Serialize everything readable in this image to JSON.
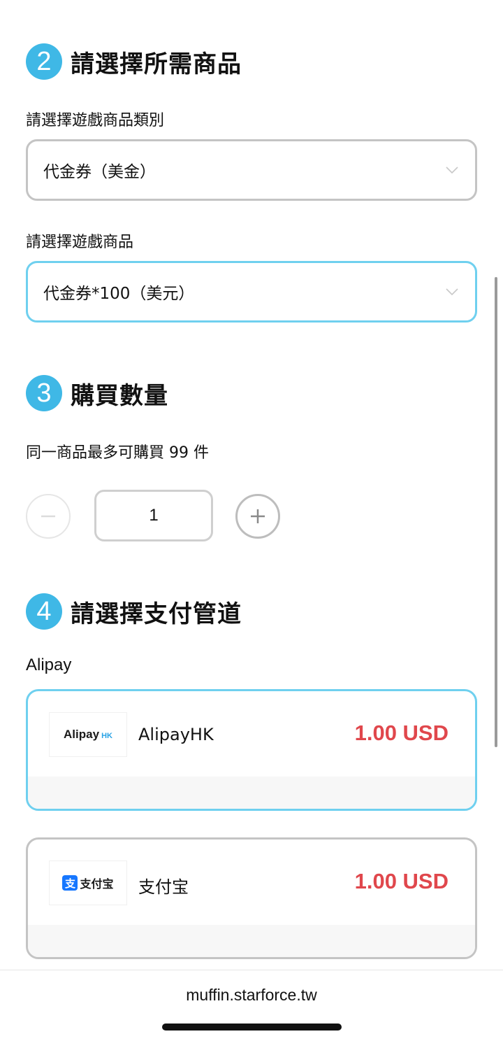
{
  "step2": {
    "number": "2",
    "title": "請選擇所需商品",
    "category_label": "請選擇遊戲商品類別",
    "category_value": "代金券（美金）",
    "product_label": "請選擇遊戲商品",
    "product_value": "代金券*100（美元）"
  },
  "step3": {
    "number": "3",
    "title": "購買數量",
    "limit_text": "同一商品最多可購買 99 件",
    "quantity": "1"
  },
  "step4": {
    "number": "4",
    "title": "請選擇支付管道",
    "group_label": "Alipay",
    "methods": [
      {
        "name": "AlipayHK",
        "price": "1.00 USD",
        "logo_text": "Alipay",
        "logo_sub": "HK",
        "icon": "alipayhk-logo"
      },
      {
        "name": "支付宝",
        "price": "1.00 USD",
        "logo_text": "支付宝",
        "logo_glyph": "支",
        "icon": "alipay-cn-logo"
      }
    ]
  },
  "browser": {
    "url": "muffin.starforce.tw"
  },
  "colors": {
    "accent": "#3fb8e6",
    "active_border": "#6fd0ef",
    "price": "#e0474c",
    "alipay_blue": "#1677ff"
  }
}
